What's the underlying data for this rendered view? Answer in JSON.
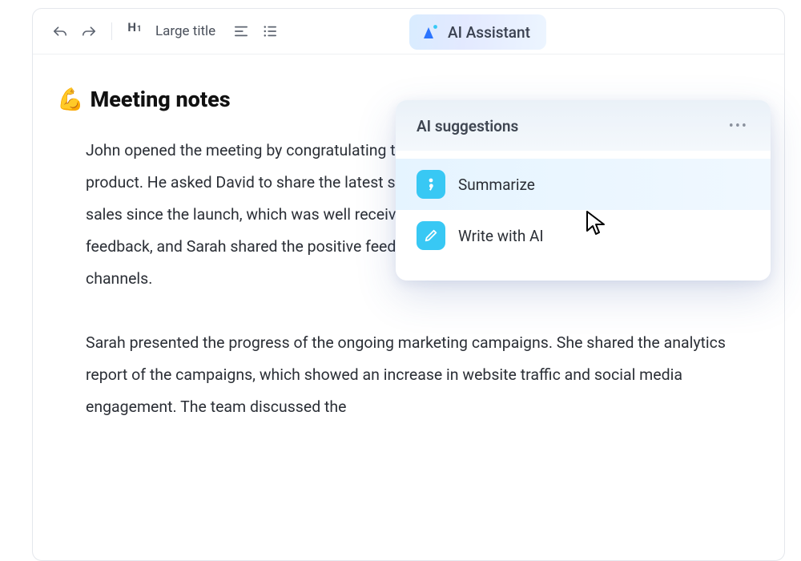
{
  "toolbar": {
    "heading_token": "H",
    "heading_level": "1",
    "heading_label": "Large title",
    "ai_button_label": "AI Assistant"
  },
  "document": {
    "title_emoji": "💪",
    "title": "Meeting notes",
    "paragraph1": "John opened the meeting by congratulating the team on the successful launch of the new product. He asked David to share the latest sales figures. David reported a 300% increase in sales since the launch, which was well received by the team. Mary asked about the customer feedback, and Sarah shared the positive feedback from the customers through social media channels.",
    "paragraph2": "Sarah presented the progress of the ongoing marketing campaigns. She shared the analytics report of the campaigns, which showed an increase in website traffic and social media engagement. The team discussed the"
  },
  "ai_popup": {
    "title": "AI suggestions",
    "items": [
      {
        "label": "Summarize",
        "icon": "semicolon-icon",
        "active": true
      },
      {
        "label": "Write with AI",
        "icon": "pencil-icon",
        "active": false
      }
    ]
  }
}
